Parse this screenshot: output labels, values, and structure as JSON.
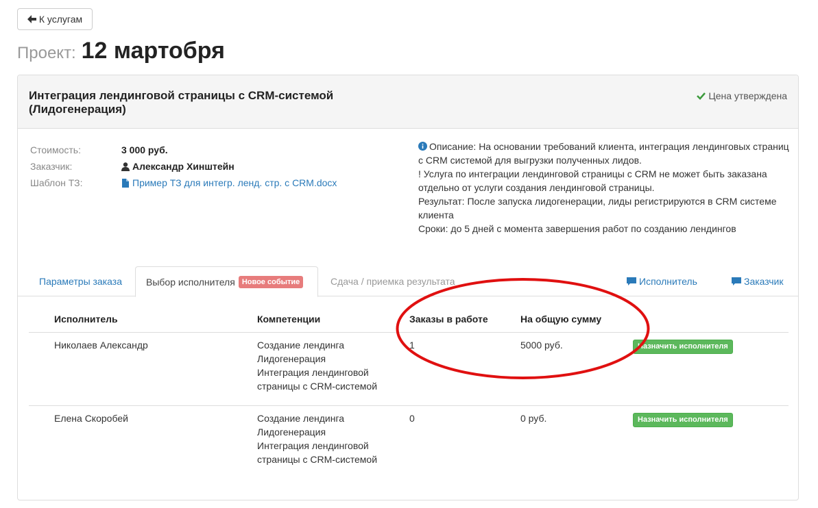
{
  "back_button": {
    "label": "К услугам"
  },
  "page_title": {
    "label": "Проект:",
    "value": "12 мартобря"
  },
  "service": {
    "title": "Интеграция лендинговой страницы с CRM-системой (Лидогенерация)",
    "status": "Цена утверждена"
  },
  "info": {
    "cost_label": "Стоимость:",
    "cost_value": "3 000 руб.",
    "client_label": "Заказчик:",
    "client_value": "Александр Хинштейн",
    "template_label": "Шаблон ТЗ:",
    "template_value": "Пример ТЗ для интегр. ленд. стр. с CRM.docx"
  },
  "description": {
    "line1": "Описание: На основании требований клиента, интеграция лендинговых страниц с CRM системой для выгрузки полученных лидов.",
    "line2": "! Услуга по интеграции лендинговой страницы с CRM не может быть заказана отдельно от услуги создания лендинговой страницы.",
    "line3": "Результат: После запуска лидогенерации, лиды регистрируются в CRM системе клиента",
    "line4": "Сроки: до 5 дней с момента завершения работ по созданию лендингов"
  },
  "tabs": {
    "params": "Параметры заказа",
    "choose": "Выбор исполнителя",
    "choose_badge": "Новое событие",
    "delivery": "Сдача / приемка результата",
    "chat_executor": "Исполнитель",
    "chat_client": "Заказчик"
  },
  "table": {
    "headers": [
      "Исполнитель",
      "Компетенции",
      "Заказы в работе",
      "На общую сумму"
    ],
    "rows": [
      {
        "name": "Николаев Александр",
        "skill1": "Создание лендинга",
        "skill2": "Лидогенерация",
        "skill3": "Интеграция лендинговой страницы с CRM-системой",
        "orders": "1",
        "sum": "5000  руб.",
        "button": "Назначить исполнителя"
      },
      {
        "name": "Елена Скоробей",
        "skill1": "Создание лендинга",
        "skill2": "Лидогенерация",
        "skill3": "Интеграция лендинговой страницы с CRM-системой",
        "orders": "0",
        "sum": "0  руб.",
        "button": "Назначить исполнителя"
      }
    ]
  },
  "colors": {
    "link": "#2a7ab9",
    "success": "#5cb85c",
    "badge": "#e77c7c",
    "annotation": "#e01010"
  }
}
